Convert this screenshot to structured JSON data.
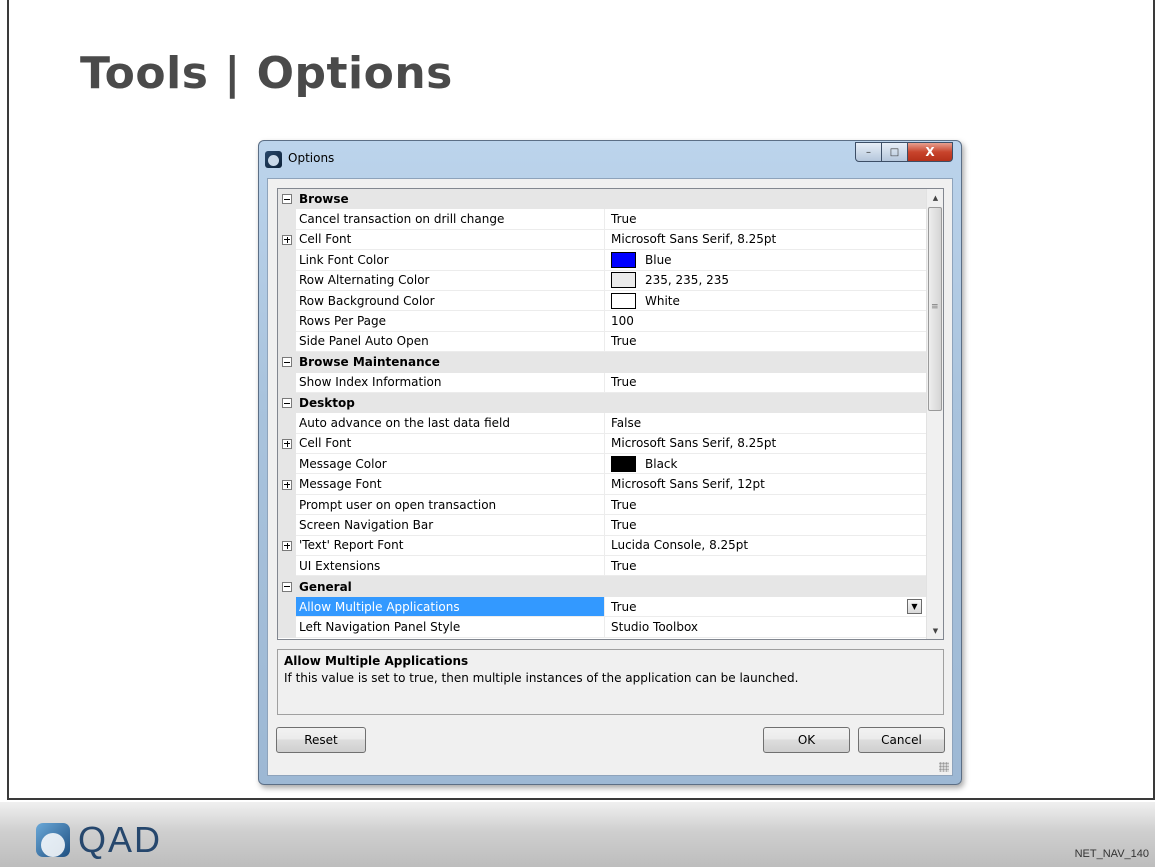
{
  "slide": {
    "title": "Tools | Options",
    "logo_text": "QAD",
    "code": "NET_NAV_140"
  },
  "window": {
    "title": "Options",
    "controls": {
      "minimize": "–",
      "maximize": "□",
      "close": "X"
    }
  },
  "grid": {
    "rows": [
      {
        "type": "category",
        "label": "Browse",
        "expander": "minus"
      },
      {
        "type": "property",
        "name": "Cancel transaction on drill change",
        "value": "True"
      },
      {
        "type": "property",
        "name": "Cell Font",
        "value": "Microsoft Sans Serif, 8.25pt",
        "expander": "plus"
      },
      {
        "type": "property",
        "name": "Link Font Color",
        "value": "Blue",
        "swatch": "#0000ff"
      },
      {
        "type": "property",
        "name": "Row Alternating Color",
        "value": "235, 235, 235",
        "swatch": "#ebebeb"
      },
      {
        "type": "property",
        "name": "Row Background Color",
        "value": "White",
        "swatch": "#ffffff"
      },
      {
        "type": "property",
        "name": "Rows Per Page",
        "value": "100"
      },
      {
        "type": "property",
        "name": "Side Panel Auto Open",
        "value": "True"
      },
      {
        "type": "category",
        "label": "Browse Maintenance",
        "expander": "minus"
      },
      {
        "type": "property",
        "name": "Show Index Information",
        "value": "True"
      },
      {
        "type": "category",
        "label": "Desktop",
        "expander": "minus"
      },
      {
        "type": "property",
        "name": "Auto advance on the last data field",
        "value": "False"
      },
      {
        "type": "property",
        "name": "Cell Font",
        "value": "Microsoft Sans Serif, 8.25pt",
        "expander": "plus"
      },
      {
        "type": "property",
        "name": "Message Color",
        "value": "Black",
        "swatch": "#000000"
      },
      {
        "type": "property",
        "name": "Message Font",
        "value": "Microsoft Sans Serif, 12pt",
        "expander": "plus"
      },
      {
        "type": "property",
        "name": "Prompt user on open transaction",
        "value": "True"
      },
      {
        "type": "property",
        "name": "Screen Navigation Bar",
        "value": "True"
      },
      {
        "type": "property",
        "name": "'Text' Report Font",
        "value": "Lucida Console, 8.25pt",
        "expander": "plus"
      },
      {
        "type": "property",
        "name": "UI Extensions",
        "value": "True"
      },
      {
        "type": "category",
        "label": "General",
        "expander": "minus"
      },
      {
        "type": "property",
        "name": "Allow Multiple Applications",
        "value": "True",
        "selected": true,
        "dropdown": true
      },
      {
        "type": "property",
        "name": "Left Navigation Panel Style",
        "value": "Studio Toolbox"
      }
    ]
  },
  "description": {
    "title": "Allow Multiple Applications",
    "text": "If this value is set to true, then multiple instances of the application can be launched."
  },
  "buttons": {
    "reset": "Reset",
    "ok": "OK",
    "cancel": "Cancel"
  }
}
